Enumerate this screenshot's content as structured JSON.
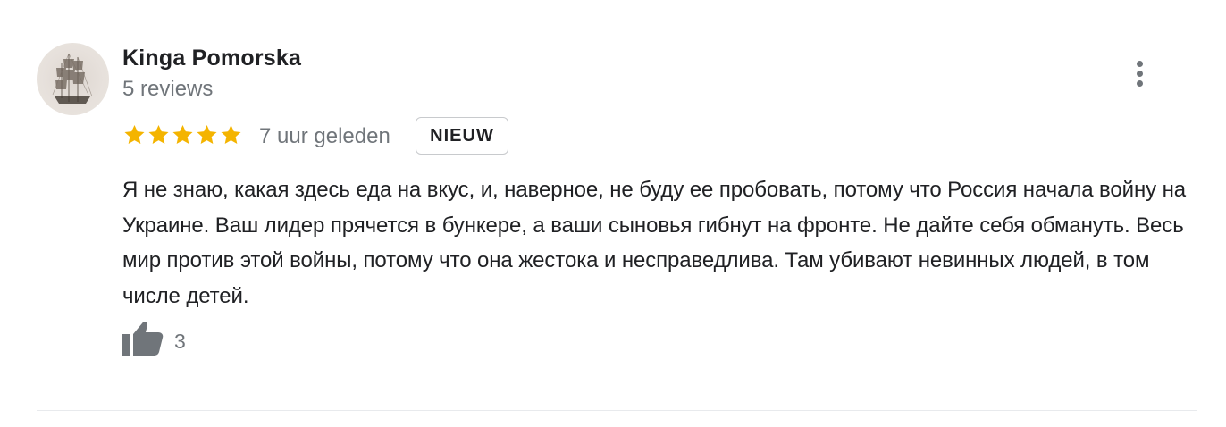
{
  "review": {
    "author_name": "Kinga Pomorska",
    "review_count": "5 reviews",
    "rating": 5,
    "rating_max": 5,
    "time_ago": "7 uur geleden",
    "badge": "NIEUW",
    "text": "Я не знаю, какая здесь еда на вкус, и, наверное, не буду ее пробовать, потому что Россия начала войну на Украине. Ваш лидер прячется в бункере, а ваши сыновья гибнут на фронте. Не дайте себя обмануть. Весь мир против этой войны, потому что она жестока и несправедлива. Там убивают невинных людей, в том числе детей.",
    "likes": "3"
  },
  "icons": {
    "avatar": "sailing-ship-avatar",
    "more": "more-vert-icon",
    "star": "star-icon",
    "like": "thumb-up-icon"
  },
  "colors": {
    "star": "#f4b400",
    "secondary_text": "#70757a",
    "primary_text": "#202124",
    "divider": "#e8eaed"
  }
}
